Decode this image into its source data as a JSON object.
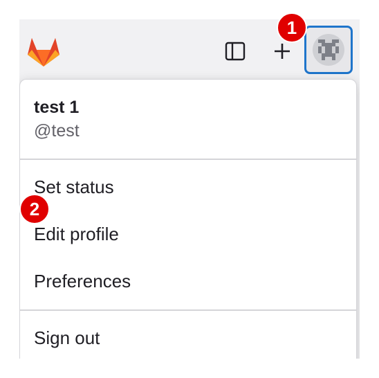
{
  "user": {
    "name": "test 1",
    "handle": "@test"
  },
  "menu": {
    "items": [
      "Set status",
      "Edit profile",
      "Preferences"
    ],
    "sign_out": "Sign out"
  },
  "icons": {
    "logo": "gitlab-tanuki-logo",
    "sidebar": "sidebar-toggle-icon",
    "plus": "plus-icon",
    "avatar": "identicon-avatar"
  },
  "badges": [
    "1",
    "2"
  ],
  "colors": {
    "badge": "#e00000",
    "focus_ring": "#1f75cb",
    "logo_orange": "#fc6d26",
    "logo_red": "#e24329",
    "logo_light": "#fca326"
  }
}
